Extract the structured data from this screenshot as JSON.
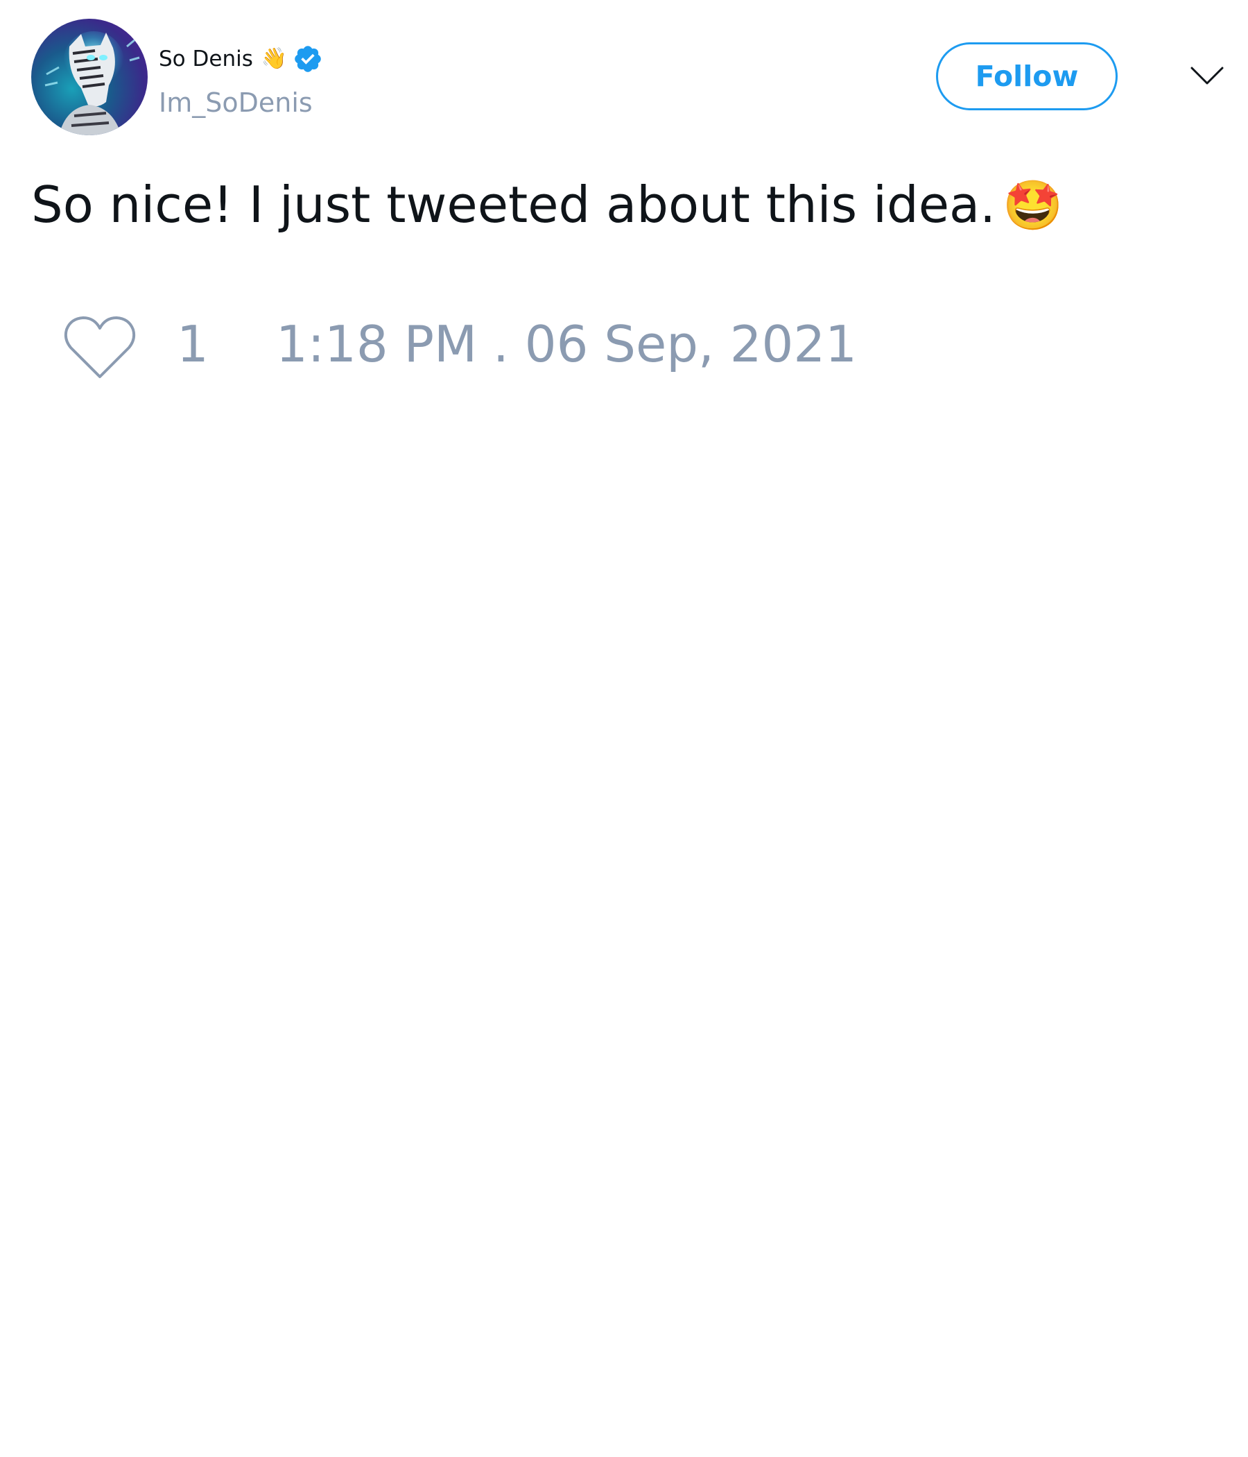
{
  "tweet": {
    "author": {
      "display_name": "So Denis",
      "name_emoji": "👋",
      "handle": "Im_SoDenis",
      "verified": true,
      "avatar_icon": "zebra-avatar"
    },
    "follow_label": "Follow",
    "menu_icon": "chevron-down-icon",
    "text": "So nice! I just tweeted about this idea.",
    "text_emoji": "🤩",
    "like_icon": "heart-icon",
    "like_count": "1",
    "timestamp": "1:18 PM . 06 Sep, 2021"
  },
  "colors": {
    "accent": "#1d9bf0",
    "muted_text": "#8b9bb1",
    "primary_text": "#0f1419",
    "background": "#ffffff"
  }
}
